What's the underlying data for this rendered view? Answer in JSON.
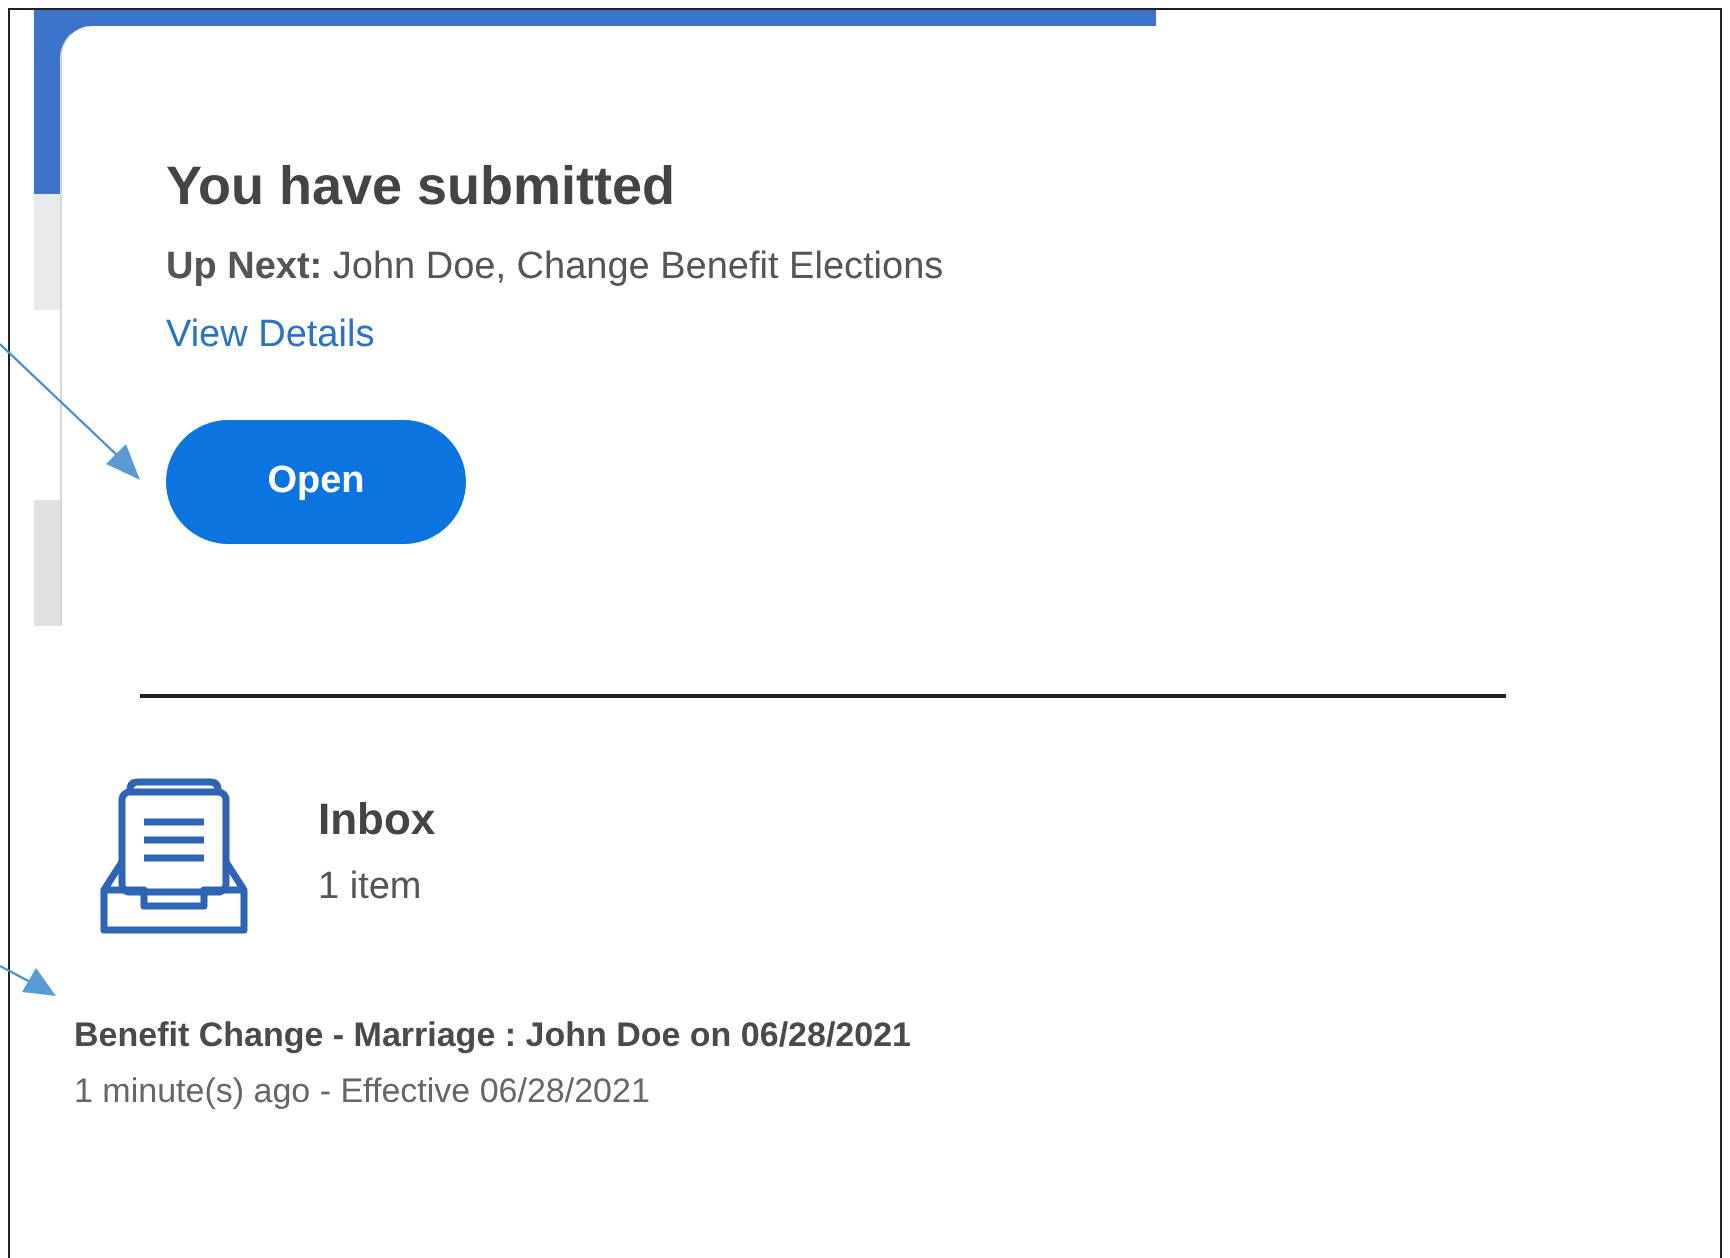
{
  "card": {
    "title": "You have submitted",
    "up_next": "**Up Next:** John Doe, Change Benefit Elections",
    "link": "View Details",
    "button": "Open"
  },
  "inbox": {
    "title": "Inbox",
    "count": "1 item",
    "items": [
      {
        "title": "Benefit Change - Marriage : John Doe on 06/28/2021",
        "meta": "1 minute(s) ago - Effective 06/28/2021"
      }
    ]
  }
}
